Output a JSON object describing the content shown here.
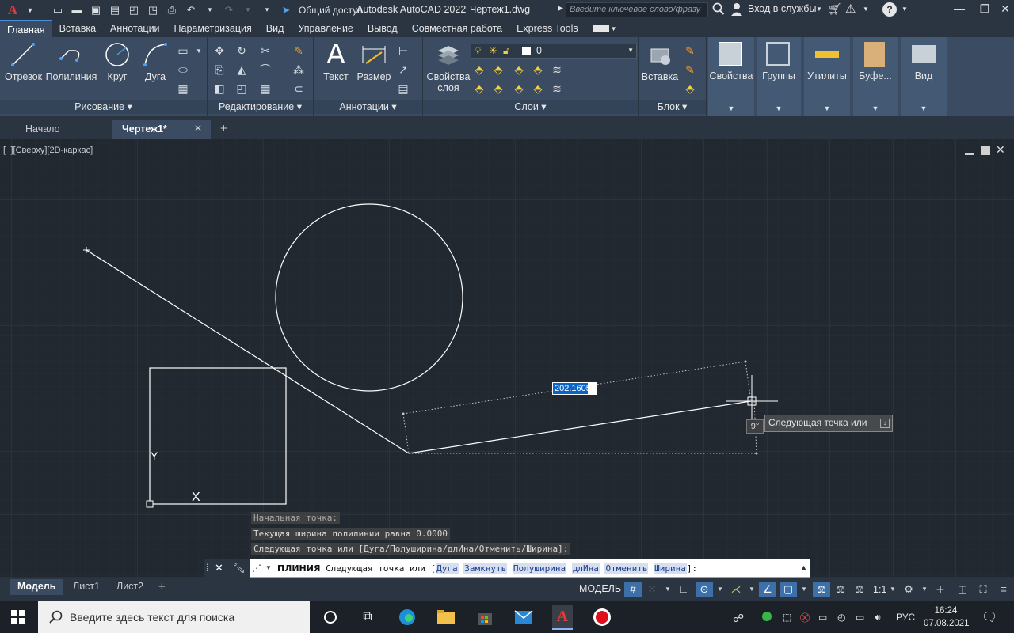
{
  "titlebar": {
    "share": "Общий доступ",
    "app_title": "Autodesk AutoCAD 2022",
    "file_title": "Чертеж1.dwg",
    "search_placeholder": "Введите ключевое слово/фразу",
    "login": "Вход в службы"
  },
  "ribbon_tabs": [
    "Главная",
    "Вставка",
    "Аннотации",
    "Параметризация",
    "Вид",
    "Управление",
    "Вывод",
    "Совместная работа",
    "Express Tools"
  ],
  "ribbon": {
    "draw": {
      "title": "Рисование",
      "line": "Отрезок",
      "polyline": "Полилиния",
      "circle": "Круг",
      "arc": "Дуга"
    },
    "modify": {
      "title": "Редактирование"
    },
    "annot": {
      "title": "Аннотации",
      "text": "Текст",
      "dim": "Размер"
    },
    "layers": {
      "title": "Слои",
      "props_1": "Свойства",
      "props_2": "слоя",
      "current": "0"
    },
    "block": {
      "title": "Блок",
      "insert": "Вставка"
    },
    "right": {
      "props": "Свойства",
      "groups": "Группы",
      "utils": "Утилиты",
      "buffer": "Буфе...",
      "view": "Вид"
    }
  },
  "file_tabs": {
    "start": "Начало",
    "current": "Чертеж1*"
  },
  "viewport": {
    "label": "[−][Сверху][2D-каркас]",
    "dim_value": "202.1605",
    "angle": "9°",
    "tooltip": "Следующая точка или",
    "ucs_y": "Y",
    "ucs_x": "X"
  },
  "history": [
    "Начальная точка:",
    "Текущая ширина полилинии равна 0.0000",
    "Следующая точка или [Дуга/Полуширина/длИна/Отменить/Ширина]:"
  ],
  "command": {
    "name": "ПЛИНИЯ",
    "prompt": "Следующая точка или [",
    "options": [
      "Дуга",
      "Замкнуть",
      "Полуширина",
      "длИна",
      "Отменить",
      "Ширина"
    ],
    "suffix": "]:"
  },
  "status": {
    "layouts": [
      "Модель",
      "Лист1",
      "Лист2"
    ],
    "model": "МОДЕЛЬ",
    "scale": "1:1"
  },
  "taskbar": {
    "search": "Введите здесь текст для поиска",
    "lang": "РУС",
    "time": "16:24",
    "date": "07.08.2021"
  }
}
